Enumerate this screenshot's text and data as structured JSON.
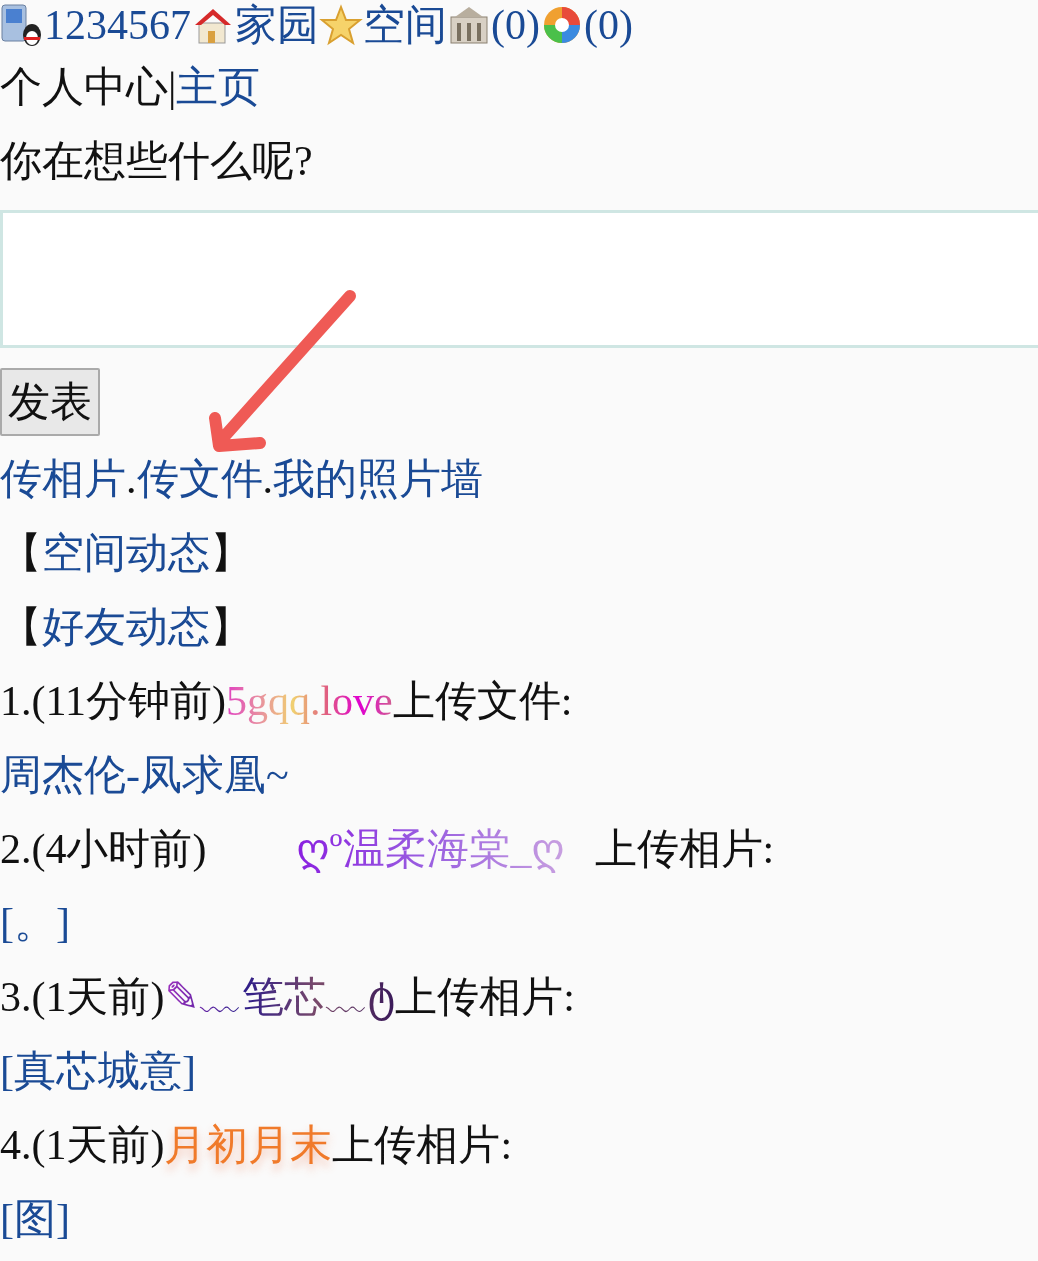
{
  "header": {
    "user_id": "1234567",
    "links": [
      {
        "kind": "house",
        "label": "家园"
      },
      {
        "kind": "star",
        "label": "空间"
      },
      {
        "kind": "building",
        "label": "(0)"
      },
      {
        "kind": "aperture",
        "label": "(0)"
      }
    ]
  },
  "nav": {
    "title": "个人中心",
    "separator": "|",
    "link": "主页"
  },
  "composer": {
    "prompt": "你在想些什么呢?",
    "button": "发表"
  },
  "upload_links": [
    {
      "label": "传相片",
      "separator_after": "."
    },
    {
      "label": "传文件",
      "separator_after": "."
    },
    {
      "label": "我的照片墙"
    }
  ],
  "sections": [
    {
      "open": "【",
      "label": "空间动态",
      "close": "】"
    },
    {
      "open": "【",
      "label": "好友动态",
      "close": "】"
    }
  ],
  "feed": [
    {
      "index": "1.",
      "time": "(11分钟前)",
      "user": "5gqq.love",
      "kind": "rainbow",
      "action": "上传文件:",
      "item": "周杰伦-凤求凰~"
    },
    {
      "index": "2.",
      "time": "(4小时前)",
      "user": "ღº温柔海棠_ღ",
      "kind": "violet",
      "action": "上传相片:",
      "item": "[。]"
    },
    {
      "index": "3.",
      "time": "(1天前)",
      "user": "✎﹏笔芯﹏ტ",
      "kind": "plum",
      "action": "上传相片:",
      "item": "[真芯城意]"
    },
    {
      "index": "4.",
      "time": "(1天前)",
      "user": "月初月末",
      "kind": "glow",
      "action": "上传相片:",
      "item": "[图]"
    }
  ]
}
